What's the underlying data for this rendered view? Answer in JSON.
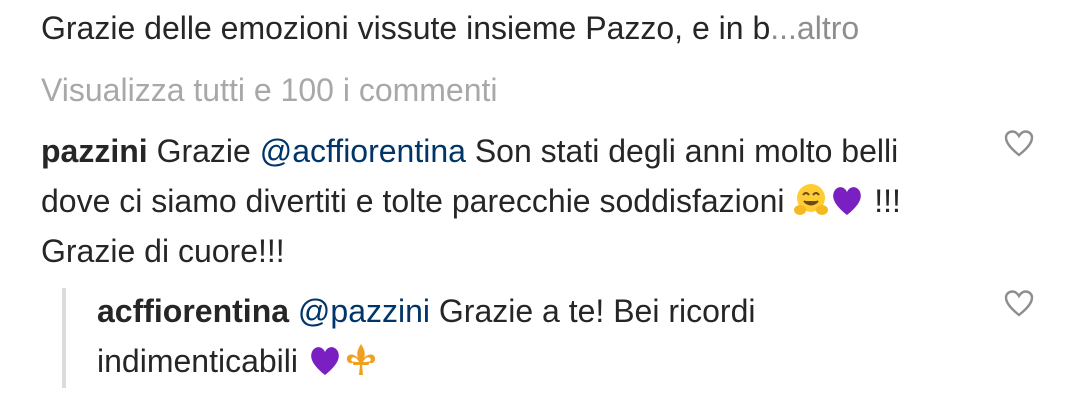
{
  "post": {
    "caption_text": "Grazie delle emozioni vissute insieme Pazzo, e in b",
    "caption_more": "...altro"
  },
  "comments_link": "Visualizza tutti e 100 i commenti",
  "comment": {
    "username": "pazzini",
    "text_1": " Grazie ",
    "mention": "@acffiorentina",
    "text_2": " Son stati degli anni molto belli dove ci siamo divertiti e tolte parecchie soddisfazioni ",
    "text_3": " !!! Grazie di cuore!!!",
    "emojis": [
      "hugging-face",
      "purple-heart"
    ]
  },
  "reply": {
    "username": "acffiorentina",
    "mention": "@pazzini",
    "text_1": " Grazie a te! Bei ricordi indimenticabili ",
    "emojis": [
      "purple-heart",
      "fleur-de-lis"
    ]
  },
  "colors": {
    "text": "#262626",
    "muted": "#a8a8a8",
    "mention": "#003569",
    "purple_heart": "#7a1fc2",
    "fleur": "#f0a020"
  }
}
